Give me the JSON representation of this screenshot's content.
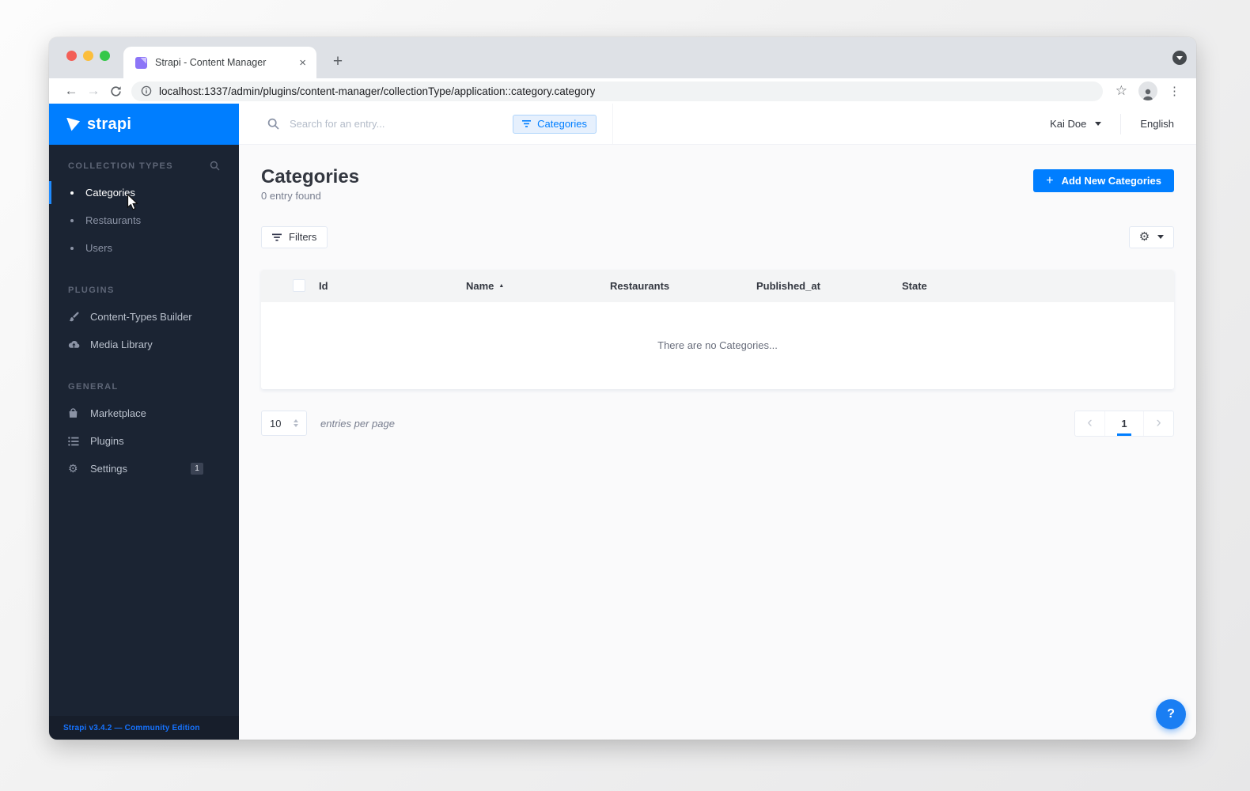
{
  "colors": {
    "accent": "#007eff",
    "sidebar_bg": "#1b2433"
  },
  "browser": {
    "tab_title": "Strapi - Content Manager",
    "url": "localhost:1337/admin/plugins/content-manager/collectionType/application::category.category"
  },
  "sidebar": {
    "brand": "strapi",
    "collection_types": {
      "title": "COLLECTION TYPES",
      "items": [
        {
          "label": "Categories"
        },
        {
          "label": "Restaurants"
        },
        {
          "label": "Users"
        }
      ]
    },
    "plugins_section": {
      "title": "PLUGINS",
      "items": [
        {
          "label": "Content-Types Builder"
        },
        {
          "label": "Media Library"
        }
      ]
    },
    "general_section": {
      "title": "GENERAL",
      "items": [
        {
          "label": "Marketplace"
        },
        {
          "label": "Plugins"
        },
        {
          "label": "Settings",
          "badge": "1"
        }
      ]
    },
    "footer": "Strapi v3.4.2 — Community Edition"
  },
  "topbar": {
    "search_placeholder": "Search for an entry...",
    "filter_chip": "Categories",
    "user_name": "Kai Doe",
    "language": "English"
  },
  "page": {
    "title": "Categories",
    "subtitle": "0 entry found",
    "add_button": "Add New Categories",
    "filters_button": "Filters"
  },
  "table": {
    "columns": [
      "Id",
      "Name",
      "Restaurants",
      "Published_at",
      "State"
    ],
    "sorted_column": "Name",
    "empty_message": "There are no Categories..."
  },
  "pagination": {
    "entries_per_page": "10",
    "entries_label": "entries per page",
    "current_page": "1"
  },
  "help_button": "?"
}
